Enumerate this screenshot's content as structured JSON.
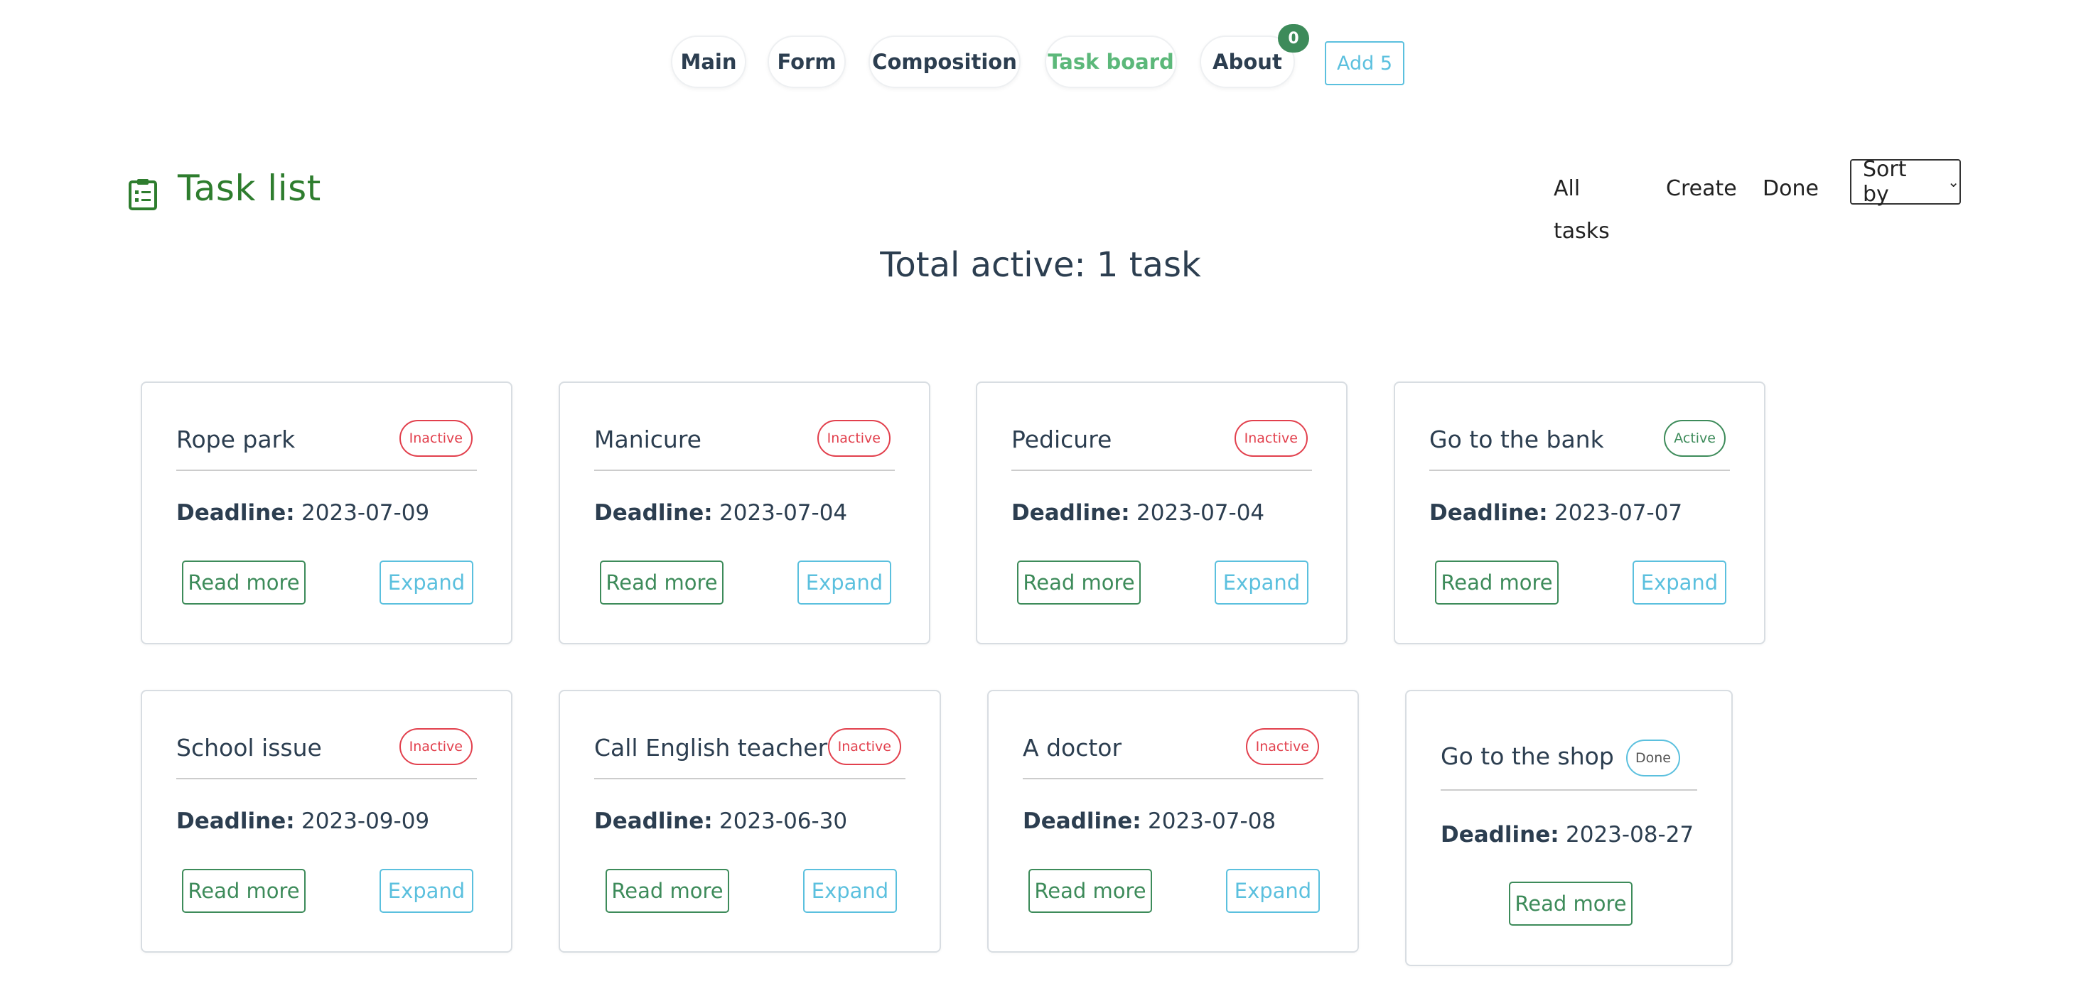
{
  "nav": {
    "items": [
      {
        "label": "Main"
      },
      {
        "label": "Form"
      },
      {
        "label": "Composition"
      },
      {
        "label": "Task board"
      },
      {
        "label": "About"
      }
    ],
    "about_badge": "0",
    "add_button": "Add 5"
  },
  "header": {
    "title": "Task list",
    "links": [
      "All tasks",
      "Create",
      "Done"
    ],
    "sort_label": "Sort by"
  },
  "summary": "Total active: 1 task",
  "labels": {
    "deadline": "Deadline:",
    "read_more": "Read more",
    "expand": "Expand"
  },
  "tasks": [
    {
      "title": "Rope park",
      "status": "Inactive",
      "deadline": "2023-07-09"
    },
    {
      "title": "Manicure",
      "status": "Inactive",
      "deadline": "2023-07-04"
    },
    {
      "title": "Pedicure",
      "status": "Inactive",
      "deadline": "2023-07-04"
    },
    {
      "title": "Go to the bank",
      "status": "Active",
      "deadline": "2023-07-07"
    },
    {
      "title": "School issue",
      "status": "Inactive",
      "deadline": "2023-09-09"
    },
    {
      "title": "Call English teacher",
      "status": "Inactive",
      "deadline": "2023-06-30"
    },
    {
      "title": "A doctor",
      "status": "Inactive",
      "deadline": "2023-07-08"
    },
    {
      "title": "Go to the shop",
      "status": "Done",
      "deadline": "2023-08-27"
    }
  ],
  "colors": {
    "brand_green": "#2e7d2e",
    "active_nav": "#5cb87a",
    "inactive": "#e2404d",
    "active": "#3d8b5a",
    "info": "#5bc0de"
  }
}
